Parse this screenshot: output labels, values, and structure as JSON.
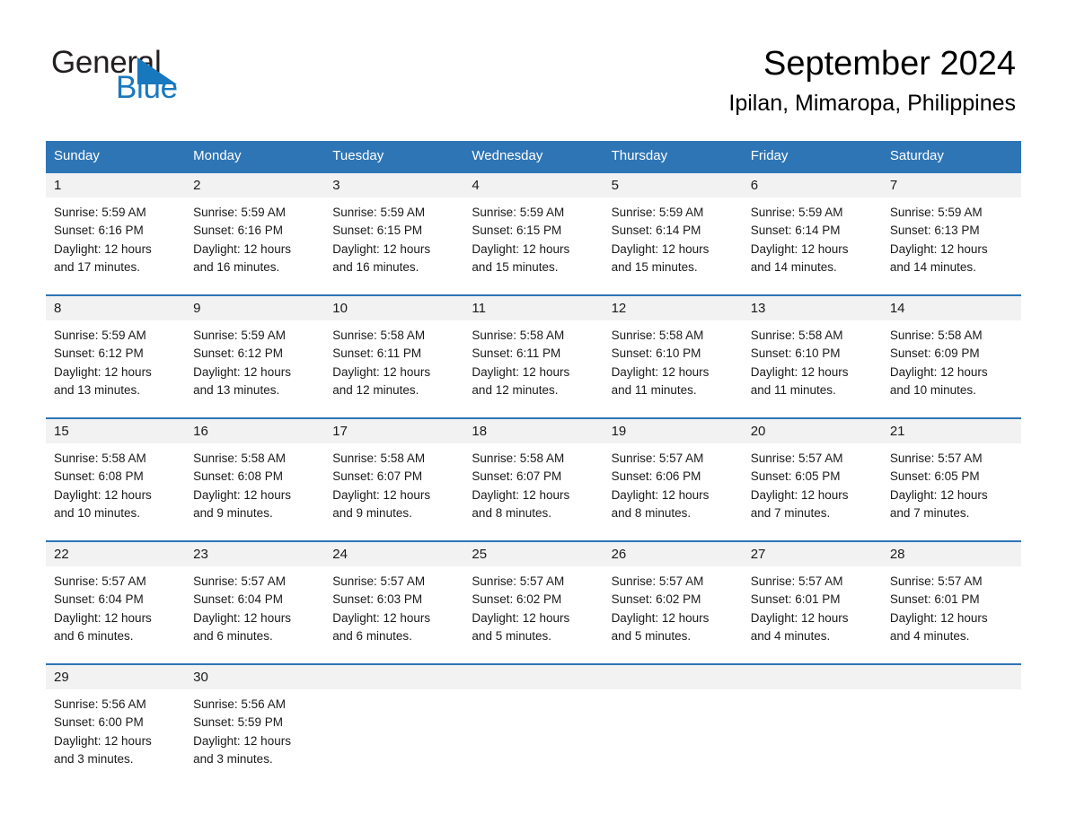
{
  "brand": {
    "name_part1": "General",
    "name_part2": "Blue",
    "accent_color": "#1878be"
  },
  "header": {
    "month_title": "September 2024",
    "location": "Ipilan, Mimaropa, Philippines"
  },
  "theme": {
    "header_blue": "#2e75b6",
    "daynum_band": "#f2f2f2",
    "text": "#1a1a1a"
  },
  "calendar": {
    "weekdays": [
      "Sunday",
      "Monday",
      "Tuesday",
      "Wednesday",
      "Thursday",
      "Friday",
      "Saturday"
    ],
    "weeks": [
      {
        "days": [
          {
            "num": "1",
            "sunrise": "Sunrise: 5:59 AM",
            "sunset": "Sunset: 6:16 PM",
            "daylight1": "Daylight: 12 hours",
            "daylight2": "and 17 minutes."
          },
          {
            "num": "2",
            "sunrise": "Sunrise: 5:59 AM",
            "sunset": "Sunset: 6:16 PM",
            "daylight1": "Daylight: 12 hours",
            "daylight2": "and 16 minutes."
          },
          {
            "num": "3",
            "sunrise": "Sunrise: 5:59 AM",
            "sunset": "Sunset: 6:15 PM",
            "daylight1": "Daylight: 12 hours",
            "daylight2": "and 16 minutes."
          },
          {
            "num": "4",
            "sunrise": "Sunrise: 5:59 AM",
            "sunset": "Sunset: 6:15 PM",
            "daylight1": "Daylight: 12 hours",
            "daylight2": "and 15 minutes."
          },
          {
            "num": "5",
            "sunrise": "Sunrise: 5:59 AM",
            "sunset": "Sunset: 6:14 PM",
            "daylight1": "Daylight: 12 hours",
            "daylight2": "and 15 minutes."
          },
          {
            "num": "6",
            "sunrise": "Sunrise: 5:59 AM",
            "sunset": "Sunset: 6:14 PM",
            "daylight1": "Daylight: 12 hours",
            "daylight2": "and 14 minutes."
          },
          {
            "num": "7",
            "sunrise": "Sunrise: 5:59 AM",
            "sunset": "Sunset: 6:13 PM",
            "daylight1": "Daylight: 12 hours",
            "daylight2": "and 14 minutes."
          }
        ]
      },
      {
        "days": [
          {
            "num": "8",
            "sunrise": "Sunrise: 5:59 AM",
            "sunset": "Sunset: 6:12 PM",
            "daylight1": "Daylight: 12 hours",
            "daylight2": "and 13 minutes."
          },
          {
            "num": "9",
            "sunrise": "Sunrise: 5:59 AM",
            "sunset": "Sunset: 6:12 PM",
            "daylight1": "Daylight: 12 hours",
            "daylight2": "and 13 minutes."
          },
          {
            "num": "10",
            "sunrise": "Sunrise: 5:58 AM",
            "sunset": "Sunset: 6:11 PM",
            "daylight1": "Daylight: 12 hours",
            "daylight2": "and 12 minutes."
          },
          {
            "num": "11",
            "sunrise": "Sunrise: 5:58 AM",
            "sunset": "Sunset: 6:11 PM",
            "daylight1": "Daylight: 12 hours",
            "daylight2": "and 12 minutes."
          },
          {
            "num": "12",
            "sunrise": "Sunrise: 5:58 AM",
            "sunset": "Sunset: 6:10 PM",
            "daylight1": "Daylight: 12 hours",
            "daylight2": "and 11 minutes."
          },
          {
            "num": "13",
            "sunrise": "Sunrise: 5:58 AM",
            "sunset": "Sunset: 6:10 PM",
            "daylight1": "Daylight: 12 hours",
            "daylight2": "and 11 minutes."
          },
          {
            "num": "14",
            "sunrise": "Sunrise: 5:58 AM",
            "sunset": "Sunset: 6:09 PM",
            "daylight1": "Daylight: 12 hours",
            "daylight2": "and 10 minutes."
          }
        ]
      },
      {
        "days": [
          {
            "num": "15",
            "sunrise": "Sunrise: 5:58 AM",
            "sunset": "Sunset: 6:08 PM",
            "daylight1": "Daylight: 12 hours",
            "daylight2": "and 10 minutes."
          },
          {
            "num": "16",
            "sunrise": "Sunrise: 5:58 AM",
            "sunset": "Sunset: 6:08 PM",
            "daylight1": "Daylight: 12 hours",
            "daylight2": "and 9 minutes."
          },
          {
            "num": "17",
            "sunrise": "Sunrise: 5:58 AM",
            "sunset": "Sunset: 6:07 PM",
            "daylight1": "Daylight: 12 hours",
            "daylight2": "and 9 minutes."
          },
          {
            "num": "18",
            "sunrise": "Sunrise: 5:58 AM",
            "sunset": "Sunset: 6:07 PM",
            "daylight1": "Daylight: 12 hours",
            "daylight2": "and 8 minutes."
          },
          {
            "num": "19",
            "sunrise": "Sunrise: 5:57 AM",
            "sunset": "Sunset: 6:06 PM",
            "daylight1": "Daylight: 12 hours",
            "daylight2": "and 8 minutes."
          },
          {
            "num": "20",
            "sunrise": "Sunrise: 5:57 AM",
            "sunset": "Sunset: 6:05 PM",
            "daylight1": "Daylight: 12 hours",
            "daylight2": "and 7 minutes."
          },
          {
            "num": "21",
            "sunrise": "Sunrise: 5:57 AM",
            "sunset": "Sunset: 6:05 PM",
            "daylight1": "Daylight: 12 hours",
            "daylight2": "and 7 minutes."
          }
        ]
      },
      {
        "days": [
          {
            "num": "22",
            "sunrise": "Sunrise: 5:57 AM",
            "sunset": "Sunset: 6:04 PM",
            "daylight1": "Daylight: 12 hours",
            "daylight2": "and 6 minutes."
          },
          {
            "num": "23",
            "sunrise": "Sunrise: 5:57 AM",
            "sunset": "Sunset: 6:04 PM",
            "daylight1": "Daylight: 12 hours",
            "daylight2": "and 6 minutes."
          },
          {
            "num": "24",
            "sunrise": "Sunrise: 5:57 AM",
            "sunset": "Sunset: 6:03 PM",
            "daylight1": "Daylight: 12 hours",
            "daylight2": "and 6 minutes."
          },
          {
            "num": "25",
            "sunrise": "Sunrise: 5:57 AM",
            "sunset": "Sunset: 6:02 PM",
            "daylight1": "Daylight: 12 hours",
            "daylight2": "and 5 minutes."
          },
          {
            "num": "26",
            "sunrise": "Sunrise: 5:57 AM",
            "sunset": "Sunset: 6:02 PM",
            "daylight1": "Daylight: 12 hours",
            "daylight2": "and 5 minutes."
          },
          {
            "num": "27",
            "sunrise": "Sunrise: 5:57 AM",
            "sunset": "Sunset: 6:01 PM",
            "daylight1": "Daylight: 12 hours",
            "daylight2": "and 4 minutes."
          },
          {
            "num": "28",
            "sunrise": "Sunrise: 5:57 AM",
            "sunset": "Sunset: 6:01 PM",
            "daylight1": "Daylight: 12 hours",
            "daylight2": "and 4 minutes."
          }
        ]
      },
      {
        "days": [
          {
            "num": "29",
            "sunrise": "Sunrise: 5:56 AM",
            "sunset": "Sunset: 6:00 PM",
            "daylight1": "Daylight: 12 hours",
            "daylight2": "and 3 minutes."
          },
          {
            "num": "30",
            "sunrise": "Sunrise: 5:56 AM",
            "sunset": "Sunset: 5:59 PM",
            "daylight1": "Daylight: 12 hours",
            "daylight2": "and 3 minutes."
          },
          {
            "num": "",
            "sunrise": "",
            "sunset": "",
            "daylight1": "",
            "daylight2": ""
          },
          {
            "num": "",
            "sunrise": "",
            "sunset": "",
            "daylight1": "",
            "daylight2": ""
          },
          {
            "num": "",
            "sunrise": "",
            "sunset": "",
            "daylight1": "",
            "daylight2": ""
          },
          {
            "num": "",
            "sunrise": "",
            "sunset": "",
            "daylight1": "",
            "daylight2": ""
          },
          {
            "num": "",
            "sunrise": "",
            "sunset": "",
            "daylight1": "",
            "daylight2": ""
          }
        ]
      }
    ]
  }
}
